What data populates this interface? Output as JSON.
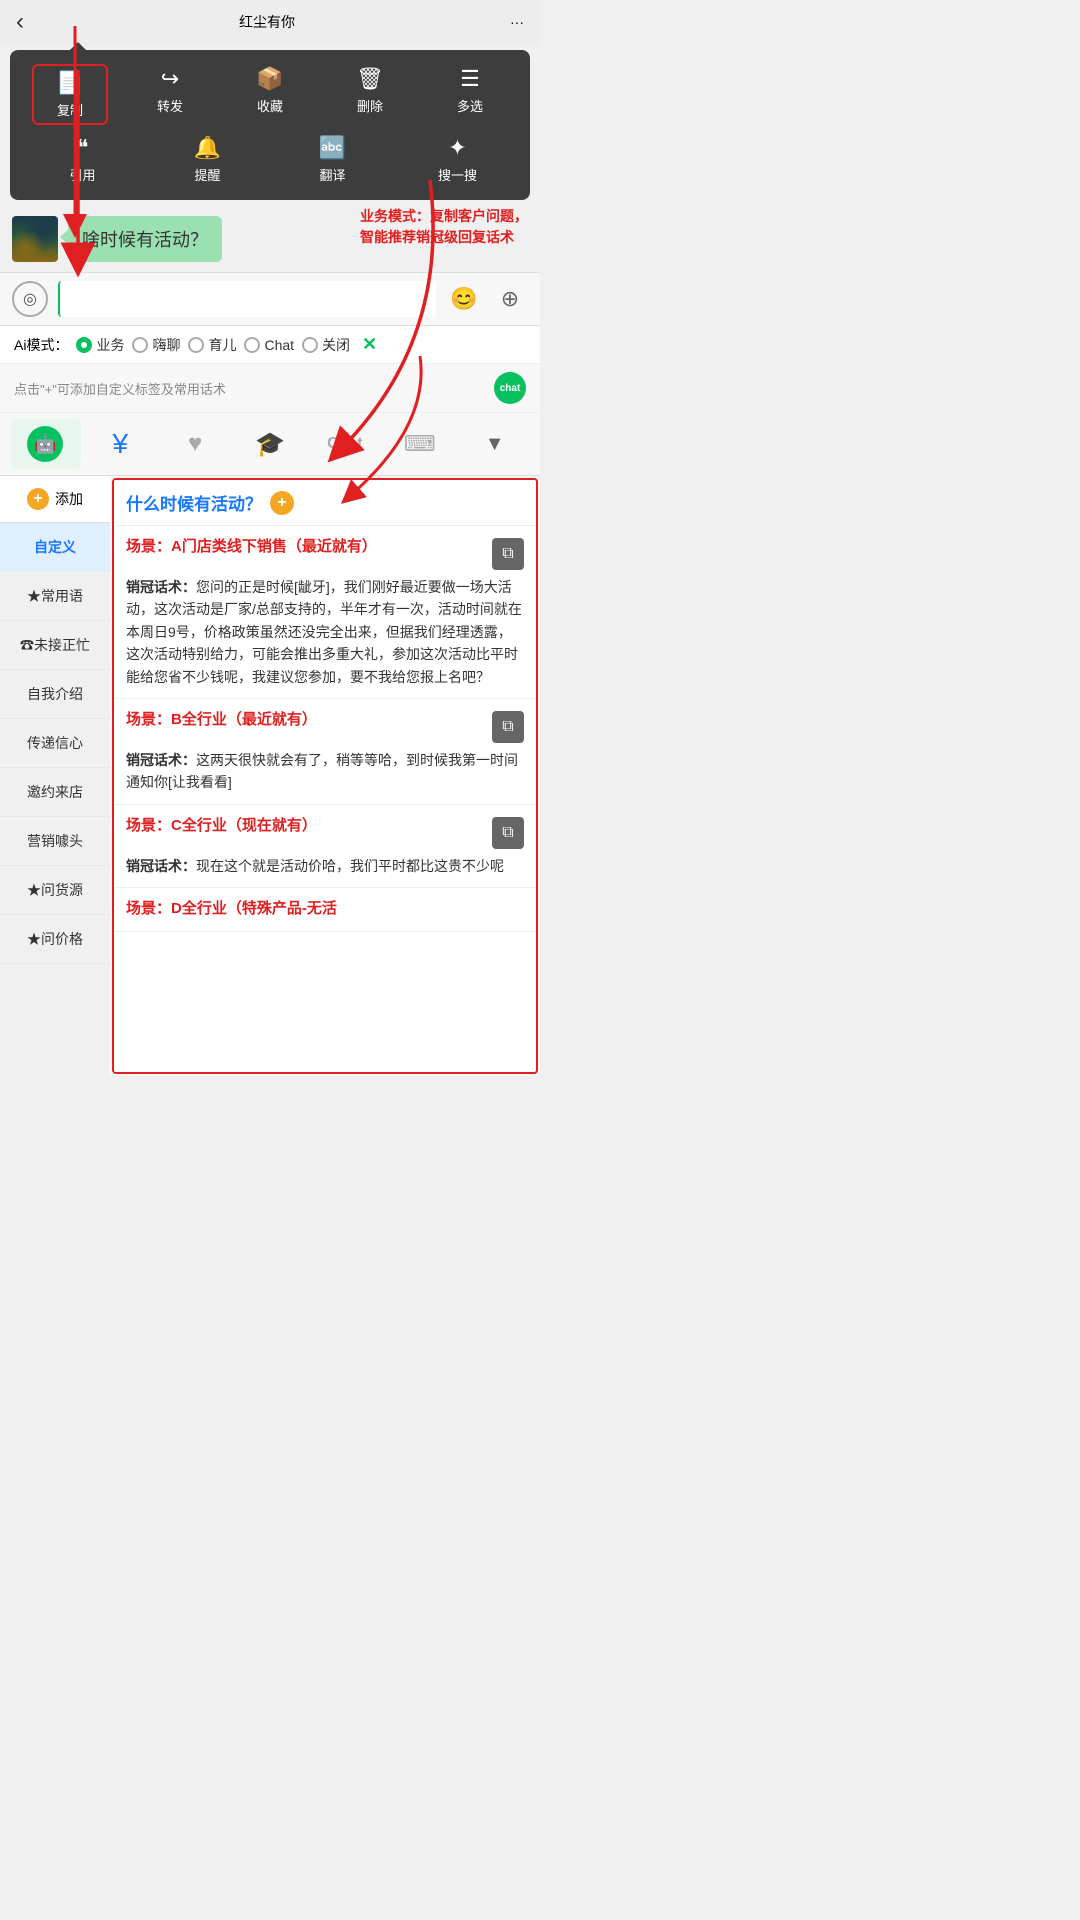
{
  "header": {
    "back_label": "‹",
    "title": "红尘有你",
    "more_label": "···"
  },
  "context_menu": {
    "row1": [
      {
        "id": "copy",
        "icon": "📋",
        "label": "复制",
        "highlighted": true
      },
      {
        "id": "forward",
        "icon": "↪",
        "label": "转发"
      },
      {
        "id": "collect",
        "icon": "🎁",
        "label": "收藏"
      },
      {
        "id": "delete",
        "icon": "🗑",
        "label": "删除"
      },
      {
        "id": "multiselect",
        "icon": "☰",
        "label": "多选"
      }
    ],
    "row2": [
      {
        "id": "quote",
        "icon": "❝",
        "label": "引用"
      },
      {
        "id": "remind",
        "icon": "🔔",
        "label": "提醒"
      },
      {
        "id": "translate",
        "icon": "🔤",
        "label": "翻译"
      },
      {
        "id": "search",
        "icon": "✦",
        "label": "搜一搜"
      }
    ]
  },
  "chat": {
    "bubble_text": "啥时候有活动？"
  },
  "annotation": {
    "text": "业务模式：复制客户问题，\n智能推荐销冠级回复话术"
  },
  "input_bar": {
    "placeholder": "",
    "emoji_icon": "😊",
    "plus_icon": "+"
  },
  "ai_modes": {
    "label": "Ai模式：",
    "options": [
      {
        "id": "business",
        "label": "业务",
        "active": true
      },
      {
        "id": "chat",
        "label": "嗨聊",
        "active": false
      },
      {
        "id": "parenting",
        "label": "育儿",
        "active": false
      },
      {
        "id": "chat2",
        "label": "Chat",
        "active": false
      },
      {
        "id": "off",
        "label": "关闭",
        "active": false
      }
    ],
    "close_label": "✕"
  },
  "hint_bar": {
    "text": "点击\"+\"可添加自定义标签及常用话术",
    "badge_text": "chat"
  },
  "toolbar": {
    "items": [
      {
        "id": "robot",
        "icon": "🤖",
        "badge": "chat",
        "active": true
      },
      {
        "id": "yuan",
        "icon": "¥",
        "active": false
      },
      {
        "id": "heart",
        "icon": "♥",
        "active": false
      },
      {
        "id": "graduation",
        "icon": "🎓",
        "active": false
      },
      {
        "id": "chat_text",
        "label": "Chat",
        "active": false
      },
      {
        "id": "keyboard",
        "icon": "⌨",
        "active": false
      }
    ],
    "arrow": "▼"
  },
  "sidebar": {
    "add_label": "添加",
    "items": [
      {
        "id": "custom",
        "label": "自定义",
        "active": true
      },
      {
        "id": "common",
        "label": "★常用语"
      },
      {
        "id": "busy",
        "label": "☎未接正忙"
      },
      {
        "id": "intro",
        "label": "自我介绍"
      },
      {
        "id": "confidence",
        "label": "传递信心"
      },
      {
        "id": "invite",
        "label": "邀约来店"
      },
      {
        "id": "marketing",
        "label": "营销噱头"
      },
      {
        "id": "source",
        "label": "★问货源"
      },
      {
        "id": "price",
        "label": "★问价格"
      }
    ]
  },
  "content": {
    "question": "什么时候有活动？",
    "scenarios": [
      {
        "id": "A",
        "title": "场景：A门店类线下销售（最近就有）",
        "content_label": "销冠话术：",
        "content": "您问的正是时候[龇牙]，我们刚好最近要做一场大活动，这次活动是厂家/总部支持的，半年才有一次，活动时间就在本周日9号，价格政策虽然还没完全出来，但据我们经理透露，这次活动特别给力，可能会推出多重大礼，参加这次活动比平时能给您省不少钱呢，我建议您参加，要不我给您报上名吧？"
      },
      {
        "id": "B",
        "title": "场景：B全行业（最近就有）",
        "content_label": "销冠话术：",
        "content": "这两天很快就会有了，稍等等哈，到时候我第一时间通知你[让我看看]"
      },
      {
        "id": "C",
        "title": "场景：C全行业（现在就有）",
        "content_label": "销冠话术：",
        "content": "现在这个就是活动价哈，我们平时都比这贵不少呢"
      },
      {
        "id": "D",
        "title": "场景：D全行业（特殊产品-无活",
        "content_label": "",
        "content": ""
      }
    ]
  }
}
